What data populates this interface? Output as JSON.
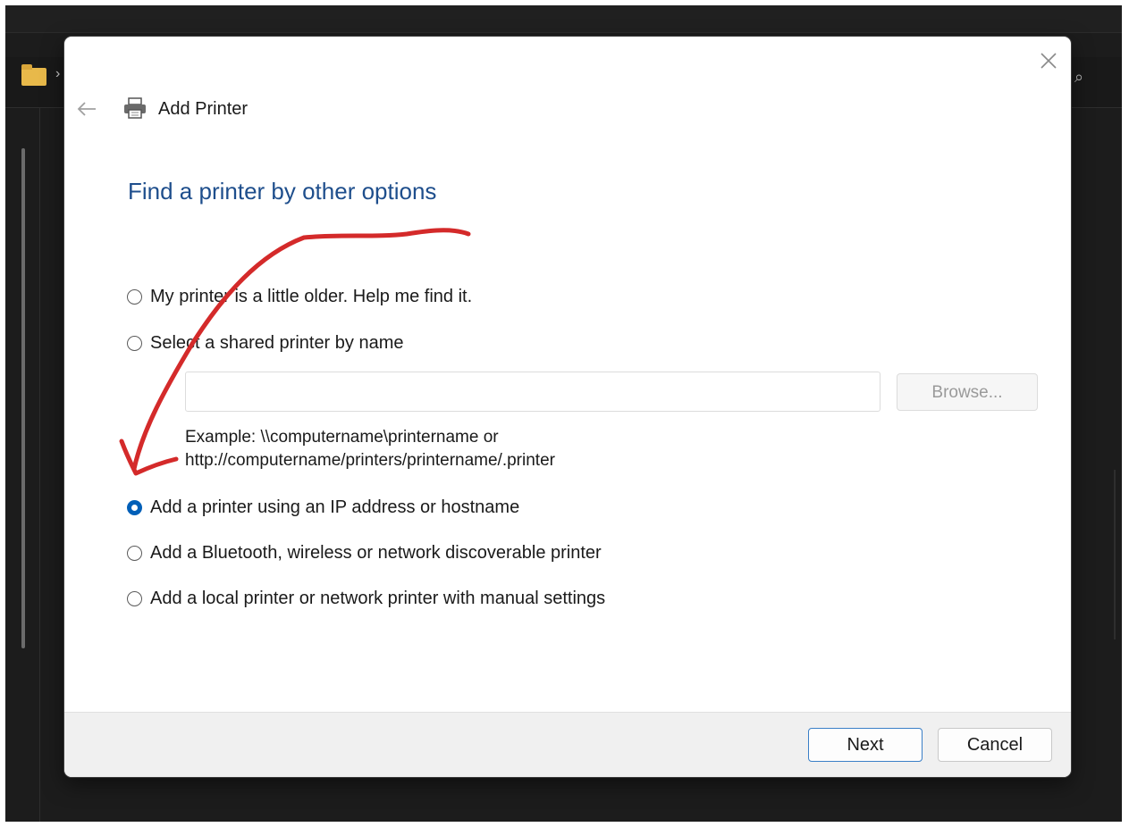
{
  "dialog": {
    "title": "Add Printer",
    "close_icon": "close-icon",
    "back_icon": "back-arrow-icon",
    "title_icon": "printer-icon",
    "heading": "Find a printer by other options"
  },
  "options": [
    {
      "label": "My printer is a little older. Help me find it.",
      "checked": false
    },
    {
      "label": "Select a shared printer by name",
      "checked": false
    },
    {
      "label": "Add a printer using an IP address or hostname",
      "checked": true
    },
    {
      "label": "Add a Bluetooth, wireless or network discoverable printer",
      "checked": false
    },
    {
      "label": "Add a local printer or network printer with manual settings",
      "checked": false
    }
  ],
  "shared_printer": {
    "value": "",
    "browse_label": "Browse...",
    "example_line1": "Example: \\\\computername\\printername or",
    "example_line2": "http://computername/printers/printername/.printer"
  },
  "footer": {
    "next_label": "Next",
    "cancel_label": "Cancel"
  },
  "colors": {
    "heading": "#1e4e8c",
    "accent": "#005fb8",
    "annotation": "#d42a2a"
  }
}
